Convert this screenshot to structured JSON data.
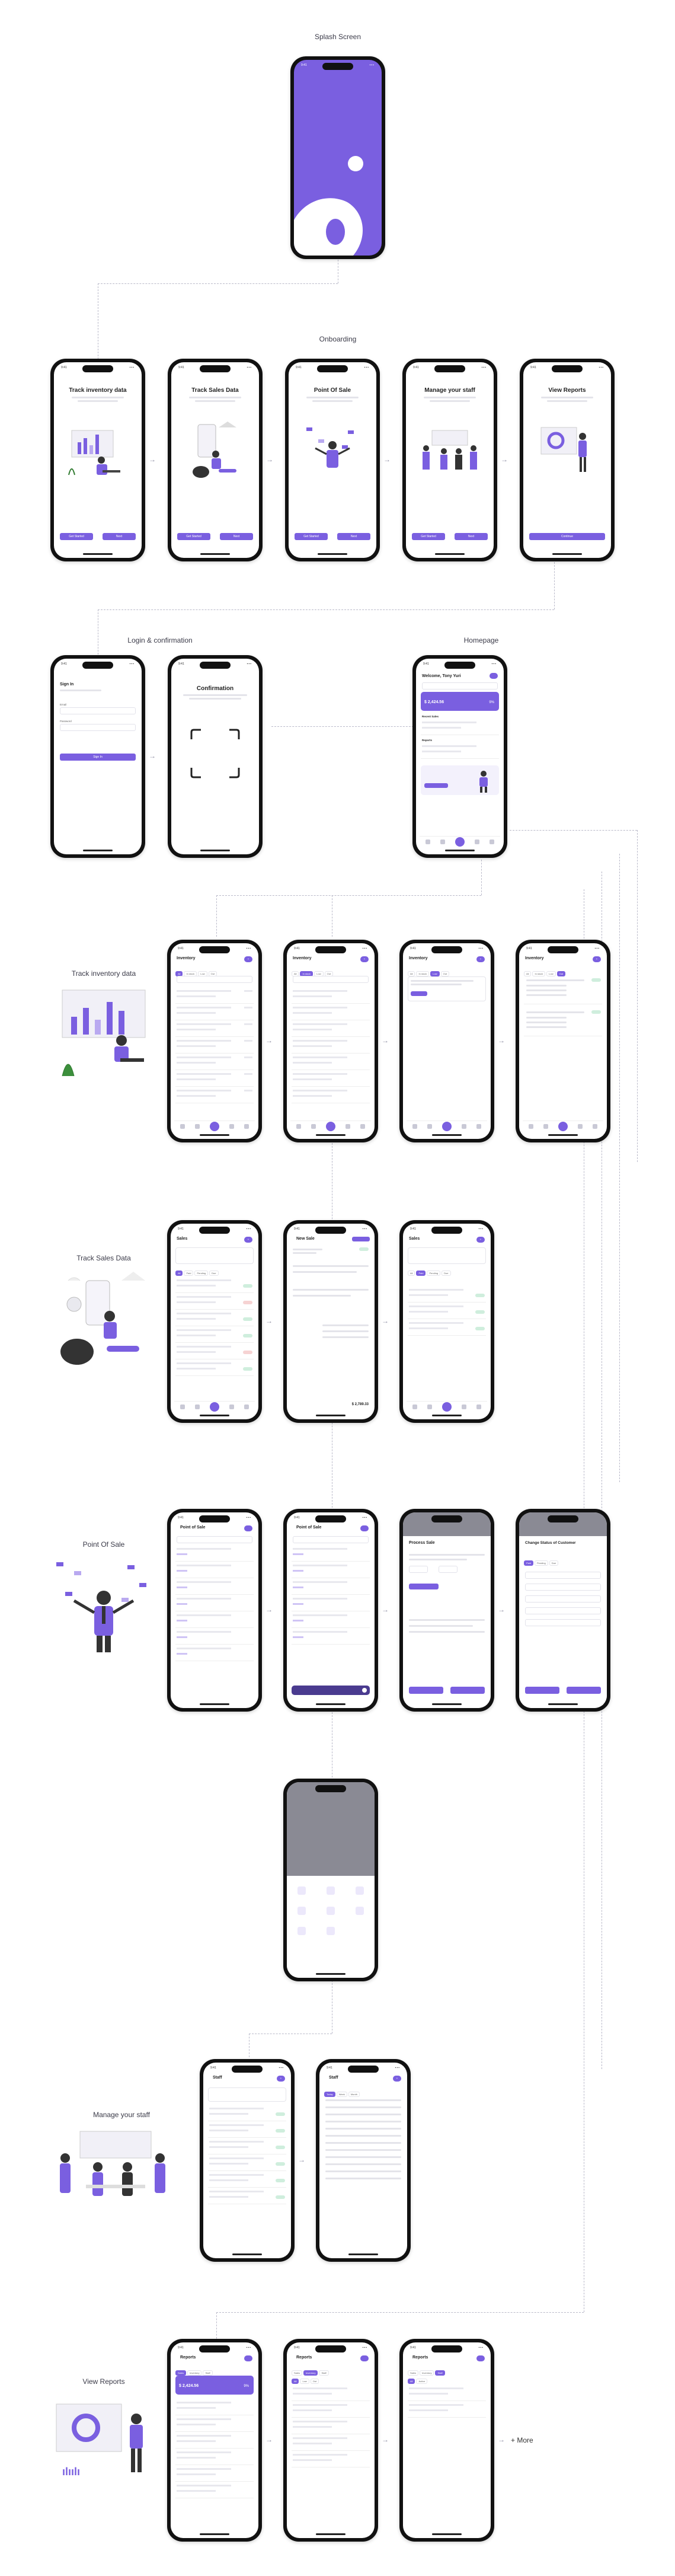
{
  "sections": {
    "splash": "Splash Screen",
    "onboarding": "Onboarding",
    "login": "Login & confirmation",
    "homepage": "Homepage",
    "inventory": "Track inventory data",
    "sales": "Track Sales Data",
    "pos": "Point Of Sale",
    "staff": "Manage your staff",
    "reports": "View Reports"
  },
  "onboarding": [
    {
      "title": "Track inventory data",
      "b1": "Get Started",
      "b2": "Next"
    },
    {
      "title": "Track Sales Data",
      "b1": "Get Started",
      "b2": "Next"
    },
    {
      "title": "Point Of Sale",
      "b1": "Get Started",
      "b2": "Next"
    },
    {
      "title": "Manage your staff",
      "b1": "Get Started",
      "b2": "Next"
    },
    {
      "title": "View Reports",
      "b1": "Continue"
    }
  ],
  "login": {
    "title": "Sign In",
    "email_label": "Email",
    "password_label": "Password",
    "button": "Sign In"
  },
  "confirm": {
    "title": "Confirmation"
  },
  "home": {
    "welcome": "Welcome, Tony Yuri",
    "amount": "$ 2,424.56",
    "percent": "9%",
    "recent_sales": "Recent Sales",
    "reports": "Reports"
  },
  "inventory": {
    "title": "Inventory"
  },
  "sales": {
    "title": "Sales",
    "new_sale": "New Sale",
    "total": "$ 2,789.33"
  },
  "pos": {
    "title": "Point of Sale",
    "process": "Process Sale",
    "change": "Change Status of Customer"
  },
  "staff": {
    "title": "Staff"
  },
  "reports": {
    "title": "Reports",
    "amount": "$ 2,424.56",
    "percent": "9%"
  },
  "more": "+ More",
  "colors": {
    "accent": "#7a5fe0"
  }
}
